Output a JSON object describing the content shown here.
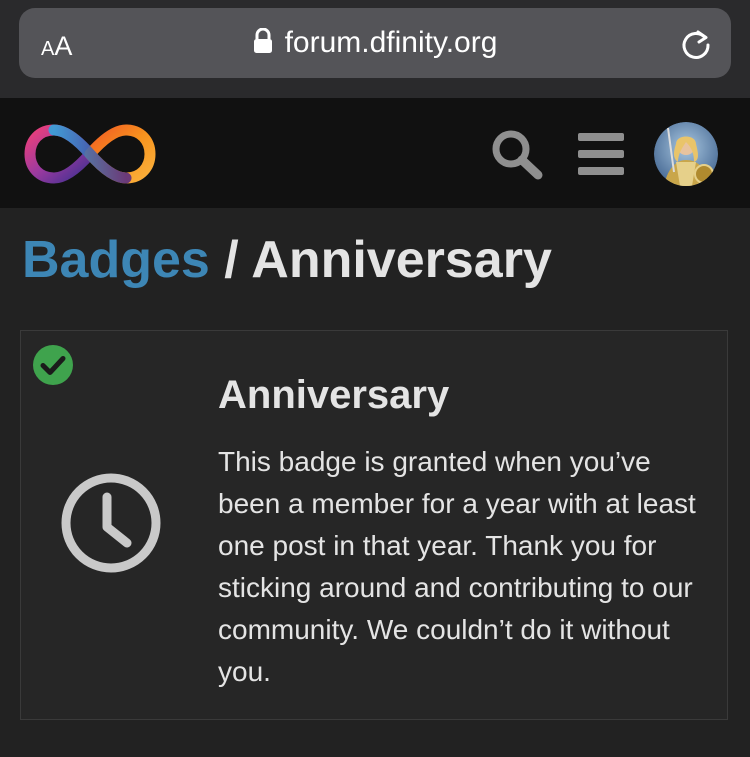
{
  "browser": {
    "text_size_button": "AA",
    "url": "forum.dfinity.org"
  },
  "header": {
    "logo_name": "dfinity-infinity-logo",
    "icons": [
      "search-icon",
      "hamburger-menu-icon",
      "user-avatar"
    ]
  },
  "breadcrumb": {
    "parent": "Badges",
    "separator": "/",
    "current": "Anniversary"
  },
  "badge": {
    "name": "Anniversary",
    "granted": true,
    "icon": "clock-icon",
    "description": "This badge is granted when you’ve been a member for a year with at least one post in that year. Thank you for sticking around and contributing to our community. We couldn’t do it without you."
  },
  "colors": {
    "link": "#3d86b5",
    "granted_check": "#3fa34d",
    "background": "#222222",
    "header_background": "#111111"
  }
}
